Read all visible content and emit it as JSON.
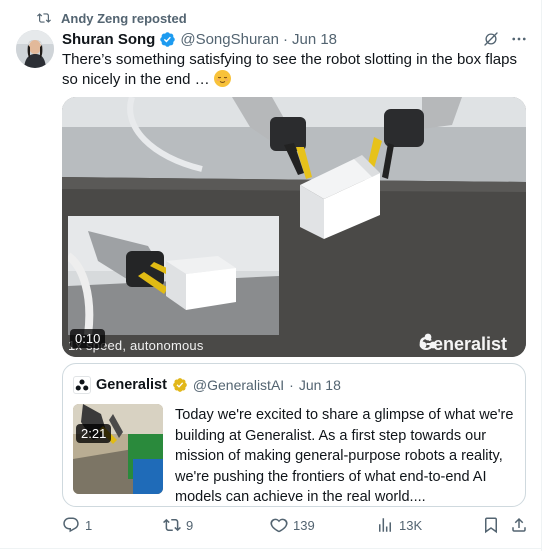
{
  "repost": {
    "icon": "repost-icon",
    "label": "Andy Zeng reposted"
  },
  "tweet": {
    "author_name": "Shuran Song",
    "handle": "@SongShuran",
    "separator": "·",
    "date": "Jun 18",
    "text": "There’s something satisfying to see the robot slotting in the box flaps so nicely in the end …",
    "emoji": "relieved-face",
    "video": {
      "duration": "0:10",
      "caption": "1x speed, autonomous",
      "watermark": "Generalist"
    }
  },
  "quote": {
    "author_name": "Generalist",
    "handle": "@GeneralistAI",
    "separator": "·",
    "date": "Jun 18",
    "thumb_duration": "2:21",
    "text": "Today we're excited to share a glimpse of what we're building at Generalist. As a first step towards our mission of making general-purpose robots a reality, we're pushing the frontiers of what end-to-end AI models can achieve in the real world...."
  },
  "actions": {
    "replies": "1",
    "reposts": "9",
    "likes": "139",
    "views": "13K"
  },
  "colors": {
    "text": "#0f1419",
    "secondary": "#536471",
    "verified_blue": "#1d9bf0",
    "verified_gold": "#e2b719",
    "border": "#cfd9de"
  }
}
